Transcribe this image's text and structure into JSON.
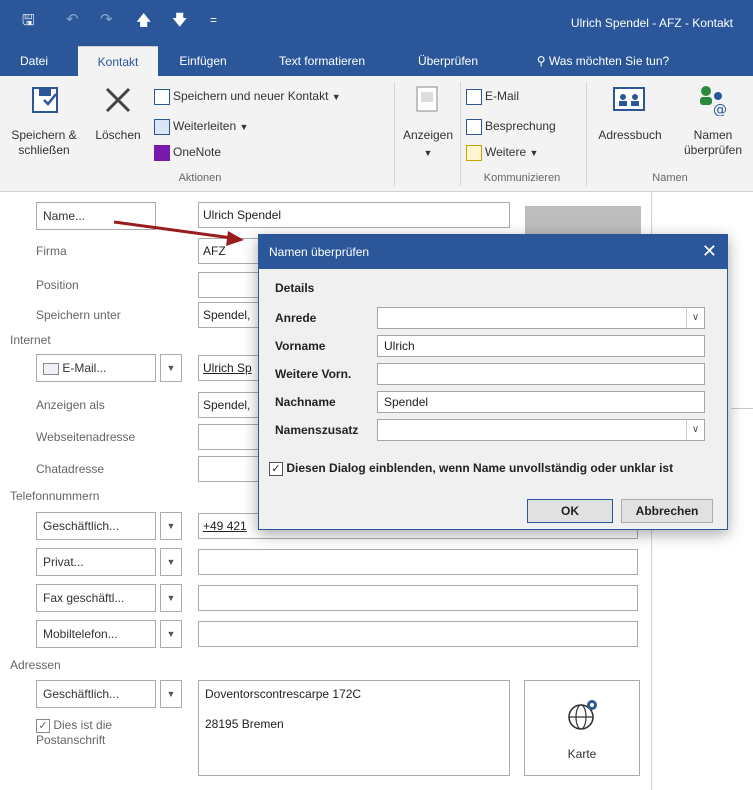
{
  "window": {
    "title": "Ulrich Spendel - AFZ - Kontakt"
  },
  "ribbon_tabs": [
    {
      "label": "Datei"
    },
    {
      "label": "Kontakt"
    },
    {
      "label": "Einfügen"
    },
    {
      "label": "Text formatieren"
    },
    {
      "label": "Überprüfen"
    },
    {
      "label": "Was möchten Sie tun?"
    }
  ],
  "ribbon": {
    "save_close": "Speichern & schließen",
    "delete": "Löschen",
    "save_new": "Speichern und neuer Kontakt",
    "forward": "Weiterleiten",
    "onenote": "OneNote",
    "group_actions": "Aktionen",
    "show": "Anzeigen",
    "email": "E-Mail",
    "meeting": "Besprechung",
    "more": "Weitere",
    "group_communicate": "Kommunizieren",
    "address_book": "Adressbuch",
    "check_names": "Namen überprüfen",
    "group_names": "Namen"
  },
  "form": {
    "name_button": "Name...",
    "name_value": "Ulrich Spendel",
    "company_label": "Firma",
    "company_value": "AFZ",
    "position_label": "Position",
    "file_as_label": "Speichern unter",
    "file_as_value": "Spendel,",
    "internet_section": "Internet",
    "email_button": "E-Mail...",
    "email_value": "Ulrich Sp",
    "display_as_label": "Anzeigen als",
    "display_as_value": "Spendel,",
    "webpage_label": "Webseitenadresse",
    "im_label": "Chatadresse",
    "phone_section": "Telefonnummern",
    "phones": [
      {
        "label": "Geschäftlich...",
        "value": "+49 421"
      },
      {
        "label": "Privat...",
        "value": ""
      },
      {
        "label": "Fax geschäftl...",
        "value": ""
      },
      {
        "label": "Mobiltelefon...",
        "value": ""
      }
    ],
    "address_section": "Adressen",
    "address_button": "Geschäftlich...",
    "address_line1": "Doventorscontrescarpe 172C",
    "address_line2": "28195 Bremen",
    "mailing_check": "Dies ist die Postanschrift",
    "map_label": "Karte"
  },
  "dialog": {
    "title": "Namen überprüfen",
    "section": "Details",
    "fields": [
      {
        "label": "Anrede",
        "value": "",
        "combo": true
      },
      {
        "label": "Vorname",
        "value": "Ulrich",
        "combo": false
      },
      {
        "label": "Weitere Vorn.",
        "value": "",
        "combo": false
      },
      {
        "label": "Nachname",
        "value": "Spendel",
        "combo": false
      },
      {
        "label": "Namenszusatz",
        "value": "",
        "combo": true
      }
    ],
    "checkbox_label": "Diesen Dialog einblenden, wenn Name unvollständig oder unklar ist",
    "checkbox_checked": true,
    "ok": "OK",
    "cancel": "Abbrechen"
  },
  "colors": {
    "accent": "#2b579a",
    "arrow": "#9b1c1c"
  }
}
